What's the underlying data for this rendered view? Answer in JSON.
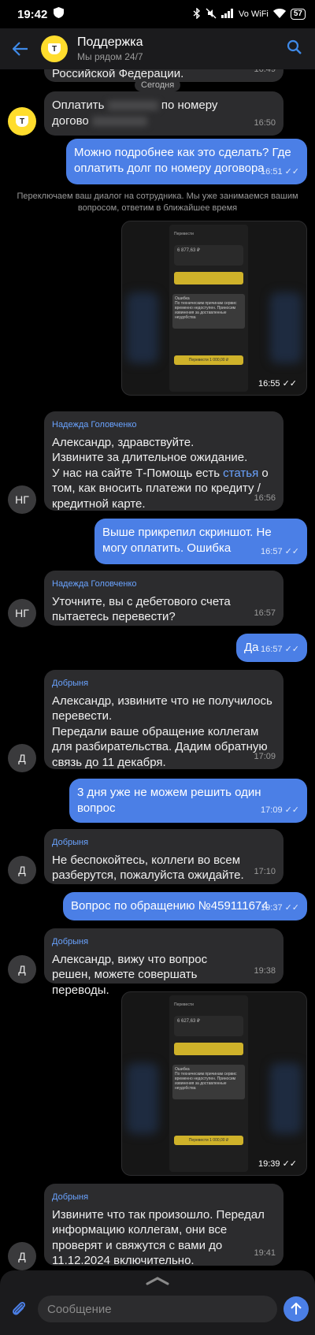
{
  "status_bar": {
    "time": "19:42",
    "battery": "57",
    "net": "Vo WiFi"
  },
  "header": {
    "title": "Поддержка",
    "subtitle": "Мы рядом 24/7",
    "logo_glyph": "Т"
  },
  "chat": {
    "date_chip": "Сегодня",
    "top_fragment": {
      "text": "Российской Федерации.",
      "time": "16:49"
    },
    "bot_msg": {
      "text_a": "Оплатить",
      "text_b": "по номеру",
      "text_c": "догово",
      "time": "16:50"
    },
    "m1": {
      "text": "Можно подробнее как это сделать? Где оплатить долг по номеру договора",
      "time": "16:51"
    },
    "system": "Переключаем ваш диалог на сотрудника. Мы уже занимаемся вашим вопросом, ответим в ближайшее время",
    "shot1": {
      "time": "16:55",
      "title": "Перевести",
      "amount": "6 877,63 ₽",
      "error_title": "Ошибка",
      "error_text": "По техническим причинам сервис временно недоступен. Приносим извинения за доставленные неудобства",
      "button": "Перевести 1 000,00 ₽"
    },
    "m2": {
      "sender": "Надежда Головченко",
      "line1": "Александр, здравствуйте.",
      "line2": "Извините за длительное ожидание.",
      "line3_pre": "У нас на сайте Т-Помощь есть ",
      "link": "статья",
      "line3_post": " о том, как вносить платежи по кредиту / кредитной карте.",
      "time": "16:56",
      "avatar": "НГ"
    },
    "m3": {
      "text": "Выше прикрепил скриншот. Не могу оплатить. Ошибка",
      "time": "16:57"
    },
    "m4": {
      "sender": "Надежда Головченко",
      "text": "Уточните, вы с дебетового счета пытаетесь перевести?",
      "time": "16:57",
      "avatar": "НГ"
    },
    "m5": {
      "text": "Да",
      "time": "16:57"
    },
    "m6": {
      "sender": "Добрыня",
      "line1": "Александр, извините что не получилось перевести.",
      "line2": "Передали ваше обращение коллегам для разбирательства. Дадим обратную связь до 11 декабря.",
      "time": "17:09",
      "avatar": "Д"
    },
    "m7": {
      "text": "3 дня уже не можем решить один вопрос",
      "time": "17:09"
    },
    "m8": {
      "sender": "Добрыня",
      "text": "Не беспокойтесь, коллеги во всем разберутся, пожалуйста ожидайте.",
      "time": "17:10",
      "avatar": "Д"
    },
    "m9": {
      "text": "Вопрос по обращению №459111674",
      "time": "19:37"
    },
    "m10": {
      "sender": "Добрыня",
      "text": "Александр, вижу что вопрос решен, можете совершать переводы.",
      "time": "19:38",
      "avatar": "Д"
    },
    "shot2": {
      "time": "19:39",
      "title": "Перевести",
      "amount": "6 627,63 ₽",
      "error_title": "Ошибка",
      "error_text": "По техническим причинам сервис временно недоступен. Приносим извинения за доставленные неудобства",
      "button": "Перевести 1 000,00 ₽"
    },
    "m11": {
      "sender": "Добрыня",
      "text": "Извините что так произошло. Передал информацию коллегам, они все проверят и свяжутся с вами до 11.12.2024 включительно.",
      "time": "19:41",
      "avatar": "Д"
    }
  },
  "composer": {
    "placeholder": "Сообщение"
  },
  "colors": {
    "accent": "#4b7fe6",
    "brand_yellow": "#ffdd2d",
    "incoming": "#2c2c2e",
    "background": "#000000"
  }
}
